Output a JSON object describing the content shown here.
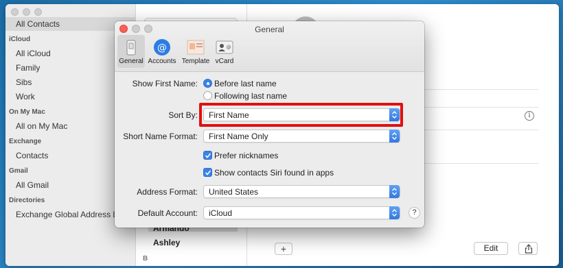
{
  "sidebar": {
    "items": [
      {
        "label": "All Contacts"
      },
      {
        "label": "iCloud"
      },
      {
        "label": "All iCloud"
      },
      {
        "label": "Family"
      },
      {
        "label": "Sibs"
      },
      {
        "label": "Work"
      },
      {
        "label": "On My Mac"
      },
      {
        "label": "All on My Mac"
      },
      {
        "label": "Exchange"
      },
      {
        "label": "Contacts"
      },
      {
        "label": "Gmail"
      },
      {
        "label": "All Gmail"
      },
      {
        "label": "Directories"
      },
      {
        "label": "Exchange Global Address List"
      }
    ]
  },
  "contact_list": {
    "names": [
      "Armando",
      "Ashley"
    ],
    "section_letter": "B"
  },
  "detail": {
    "add_label": "+",
    "edit_label": "Edit",
    "info_glyph": "i"
  },
  "dialog": {
    "title": "General",
    "toolbar": [
      {
        "label": "General",
        "icon": "switch-icon"
      },
      {
        "label": "Accounts",
        "icon": "at-icon"
      },
      {
        "label": "Template",
        "icon": "template-icon"
      },
      {
        "label": "vCard",
        "icon": "vcard-icon"
      }
    ],
    "show_first_name": {
      "label": "Show First Name:",
      "options": [
        "Before last name",
        "Following last name"
      ],
      "selected": "Before last name"
    },
    "sort_by": {
      "label": "Sort By:",
      "value": "First Name"
    },
    "short_name_format": {
      "label": "Short Name Format:",
      "value": "First Name Only"
    },
    "checkboxes": [
      {
        "label": "Prefer nicknames",
        "checked": true
      },
      {
        "label": "Show contacts Siri found in apps",
        "checked": true
      }
    ],
    "address_format": {
      "label": "Address Format:",
      "value": "United States"
    },
    "default_account": {
      "label": "Default Account:",
      "value": "iCloud"
    },
    "help_label": "?"
  },
  "colors": {
    "accent": "#3b82e6",
    "highlight": "#e01010",
    "close": "#fc5f57"
  }
}
